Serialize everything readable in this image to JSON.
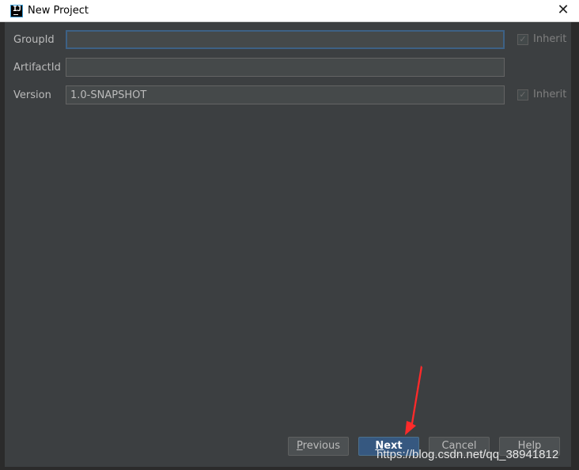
{
  "window": {
    "title": "New Project",
    "close_glyph": "✕"
  },
  "form": {
    "group_id": {
      "label": "GroupId",
      "value": "",
      "inherit_label": "Inherit",
      "inherit_checked": true
    },
    "artifact_id": {
      "label": "ArtifactId",
      "value": ""
    },
    "version": {
      "label": "Version",
      "value": "1.0-SNAPSHOT",
      "inherit_label": "Inherit",
      "inherit_checked": true
    }
  },
  "buttons": {
    "previous": {
      "mnemonic": "P",
      "rest": "revious"
    },
    "next": {
      "mnemonic": "N",
      "rest": "ext"
    },
    "cancel": {
      "mnemonic": "",
      "rest": "Cancel"
    },
    "help": {
      "mnemonic": "",
      "rest": "Help"
    }
  },
  "watermark": "https://blog.csdn.net/qq_38941812",
  "colors": {
    "accent": "#365880",
    "annotation_arrow": "#ff2a2a",
    "dialog_bg": "#3c3f41"
  },
  "icons": {
    "app": "intellij-idea-icon",
    "close": "close-icon",
    "check": "checkmark-icon"
  }
}
